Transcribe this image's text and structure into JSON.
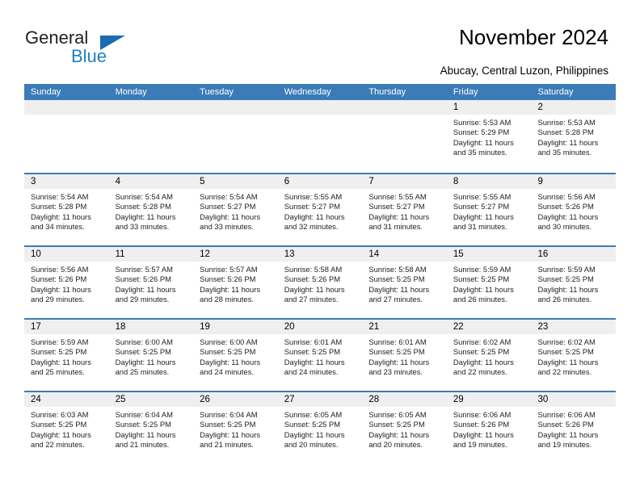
{
  "brand": {
    "name_part1": "General",
    "name_part2": "Blue",
    "accent_color": "#1f7fc4",
    "triangle_color": "#1b6cb0"
  },
  "header": {
    "title": "November 2024",
    "location": "Abucay, Central Luzon, Philippines"
  },
  "theme": {
    "header_blue": "#3b7cb8",
    "day_band_gray": "#efefef",
    "text_color": "#000000"
  },
  "weekdays": [
    "Sunday",
    "Monday",
    "Tuesday",
    "Wednesday",
    "Thursday",
    "Friday",
    "Saturday"
  ],
  "weeks": [
    [
      {
        "day": "",
        "sunrise": "",
        "sunset": "",
        "daylight_line1": "",
        "daylight_line2": "",
        "empty": true
      },
      {
        "day": "",
        "sunrise": "",
        "sunset": "",
        "daylight_line1": "",
        "daylight_line2": "",
        "empty": true
      },
      {
        "day": "",
        "sunrise": "",
        "sunset": "",
        "daylight_line1": "",
        "daylight_line2": "",
        "empty": true
      },
      {
        "day": "",
        "sunrise": "",
        "sunset": "",
        "daylight_line1": "",
        "daylight_line2": "",
        "empty": true
      },
      {
        "day": "",
        "sunrise": "",
        "sunset": "",
        "daylight_line1": "",
        "daylight_line2": "",
        "empty": true
      },
      {
        "day": "1",
        "sunrise": "Sunrise: 5:53 AM",
        "sunset": "Sunset: 5:29 PM",
        "daylight_line1": "Daylight: 11 hours",
        "daylight_line2": "and 35 minutes."
      },
      {
        "day": "2",
        "sunrise": "Sunrise: 5:53 AM",
        "sunset": "Sunset: 5:28 PM",
        "daylight_line1": "Daylight: 11 hours",
        "daylight_line2": "and 35 minutes."
      }
    ],
    [
      {
        "day": "3",
        "sunrise": "Sunrise: 5:54 AM",
        "sunset": "Sunset: 5:28 PM",
        "daylight_line1": "Daylight: 11 hours",
        "daylight_line2": "and 34 minutes."
      },
      {
        "day": "4",
        "sunrise": "Sunrise: 5:54 AM",
        "sunset": "Sunset: 5:28 PM",
        "daylight_line1": "Daylight: 11 hours",
        "daylight_line2": "and 33 minutes."
      },
      {
        "day": "5",
        "sunrise": "Sunrise: 5:54 AM",
        "sunset": "Sunset: 5:27 PM",
        "daylight_line1": "Daylight: 11 hours",
        "daylight_line2": "and 33 minutes."
      },
      {
        "day": "6",
        "sunrise": "Sunrise: 5:55 AM",
        "sunset": "Sunset: 5:27 PM",
        "daylight_line1": "Daylight: 11 hours",
        "daylight_line2": "and 32 minutes."
      },
      {
        "day": "7",
        "sunrise": "Sunrise: 5:55 AM",
        "sunset": "Sunset: 5:27 PM",
        "daylight_line1": "Daylight: 11 hours",
        "daylight_line2": "and 31 minutes."
      },
      {
        "day": "8",
        "sunrise": "Sunrise: 5:55 AM",
        "sunset": "Sunset: 5:27 PM",
        "daylight_line1": "Daylight: 11 hours",
        "daylight_line2": "and 31 minutes."
      },
      {
        "day": "9",
        "sunrise": "Sunrise: 5:56 AM",
        "sunset": "Sunset: 5:26 PM",
        "daylight_line1": "Daylight: 11 hours",
        "daylight_line2": "and 30 minutes."
      }
    ],
    [
      {
        "day": "10",
        "sunrise": "Sunrise: 5:56 AM",
        "sunset": "Sunset: 5:26 PM",
        "daylight_line1": "Daylight: 11 hours",
        "daylight_line2": "and 29 minutes."
      },
      {
        "day": "11",
        "sunrise": "Sunrise: 5:57 AM",
        "sunset": "Sunset: 5:26 PM",
        "daylight_line1": "Daylight: 11 hours",
        "daylight_line2": "and 29 minutes."
      },
      {
        "day": "12",
        "sunrise": "Sunrise: 5:57 AM",
        "sunset": "Sunset: 5:26 PM",
        "daylight_line1": "Daylight: 11 hours",
        "daylight_line2": "and 28 minutes."
      },
      {
        "day": "13",
        "sunrise": "Sunrise: 5:58 AM",
        "sunset": "Sunset: 5:26 PM",
        "daylight_line1": "Daylight: 11 hours",
        "daylight_line2": "and 27 minutes."
      },
      {
        "day": "14",
        "sunrise": "Sunrise: 5:58 AM",
        "sunset": "Sunset: 5:25 PM",
        "daylight_line1": "Daylight: 11 hours",
        "daylight_line2": "and 27 minutes."
      },
      {
        "day": "15",
        "sunrise": "Sunrise: 5:59 AM",
        "sunset": "Sunset: 5:25 PM",
        "daylight_line1": "Daylight: 11 hours",
        "daylight_line2": "and 26 minutes."
      },
      {
        "day": "16",
        "sunrise": "Sunrise: 5:59 AM",
        "sunset": "Sunset: 5:25 PM",
        "daylight_line1": "Daylight: 11 hours",
        "daylight_line2": "and 26 minutes."
      }
    ],
    [
      {
        "day": "17",
        "sunrise": "Sunrise: 5:59 AM",
        "sunset": "Sunset: 5:25 PM",
        "daylight_line1": "Daylight: 11 hours",
        "daylight_line2": "and 25 minutes."
      },
      {
        "day": "18",
        "sunrise": "Sunrise: 6:00 AM",
        "sunset": "Sunset: 5:25 PM",
        "daylight_line1": "Daylight: 11 hours",
        "daylight_line2": "and 25 minutes."
      },
      {
        "day": "19",
        "sunrise": "Sunrise: 6:00 AM",
        "sunset": "Sunset: 5:25 PM",
        "daylight_line1": "Daylight: 11 hours",
        "daylight_line2": "and 24 minutes."
      },
      {
        "day": "20",
        "sunrise": "Sunrise: 6:01 AM",
        "sunset": "Sunset: 5:25 PM",
        "daylight_line1": "Daylight: 11 hours",
        "daylight_line2": "and 24 minutes."
      },
      {
        "day": "21",
        "sunrise": "Sunrise: 6:01 AM",
        "sunset": "Sunset: 5:25 PM",
        "daylight_line1": "Daylight: 11 hours",
        "daylight_line2": "and 23 minutes."
      },
      {
        "day": "22",
        "sunrise": "Sunrise: 6:02 AM",
        "sunset": "Sunset: 5:25 PM",
        "daylight_line1": "Daylight: 11 hours",
        "daylight_line2": "and 22 minutes."
      },
      {
        "day": "23",
        "sunrise": "Sunrise: 6:02 AM",
        "sunset": "Sunset: 5:25 PM",
        "daylight_line1": "Daylight: 11 hours",
        "daylight_line2": "and 22 minutes."
      }
    ],
    [
      {
        "day": "24",
        "sunrise": "Sunrise: 6:03 AM",
        "sunset": "Sunset: 5:25 PM",
        "daylight_line1": "Daylight: 11 hours",
        "daylight_line2": "and 22 minutes."
      },
      {
        "day": "25",
        "sunrise": "Sunrise: 6:04 AM",
        "sunset": "Sunset: 5:25 PM",
        "daylight_line1": "Daylight: 11 hours",
        "daylight_line2": "and 21 minutes."
      },
      {
        "day": "26",
        "sunrise": "Sunrise: 6:04 AM",
        "sunset": "Sunset: 5:25 PM",
        "daylight_line1": "Daylight: 11 hours",
        "daylight_line2": "and 21 minutes."
      },
      {
        "day": "27",
        "sunrise": "Sunrise: 6:05 AM",
        "sunset": "Sunset: 5:25 PM",
        "daylight_line1": "Daylight: 11 hours",
        "daylight_line2": "and 20 minutes."
      },
      {
        "day": "28",
        "sunrise": "Sunrise: 6:05 AM",
        "sunset": "Sunset: 5:25 PM",
        "daylight_line1": "Daylight: 11 hours",
        "daylight_line2": "and 20 minutes."
      },
      {
        "day": "29",
        "sunrise": "Sunrise: 6:06 AM",
        "sunset": "Sunset: 5:26 PM",
        "daylight_line1": "Daylight: 11 hours",
        "daylight_line2": "and 19 minutes."
      },
      {
        "day": "30",
        "sunrise": "Sunrise: 6:06 AM",
        "sunset": "Sunset: 5:26 PM",
        "daylight_line1": "Daylight: 11 hours",
        "daylight_line2": "and 19 minutes."
      }
    ]
  ]
}
